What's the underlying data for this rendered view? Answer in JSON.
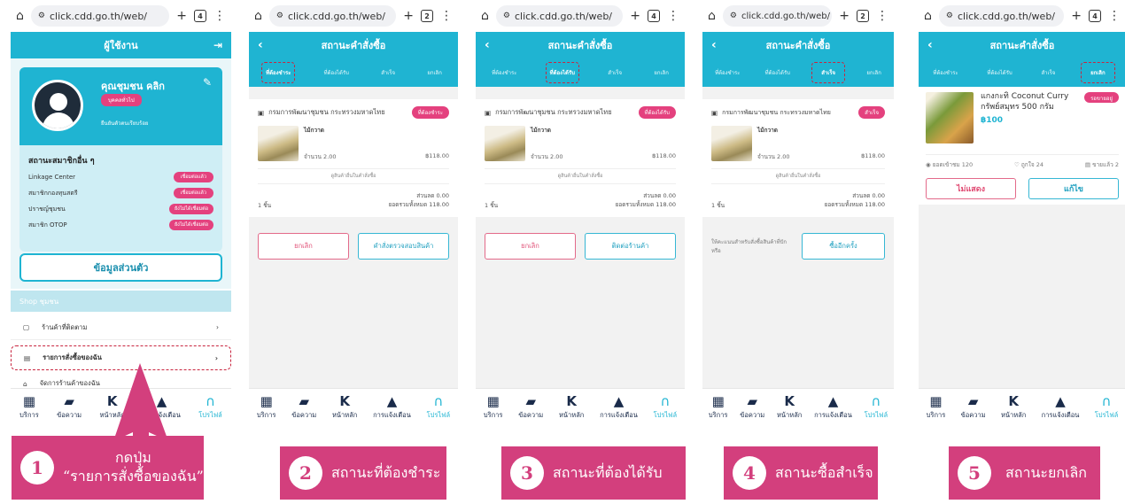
{
  "browser": {
    "url": "click.cdd.go.th/web/",
    "tab_counts": [
      "4",
      "2",
      "4",
      "2",
      "4"
    ]
  },
  "profile": {
    "header_title": "ผู้ใช้งาน",
    "name": "คุณชุมชน คลิก",
    "tag": "บุคคลทั่วไป",
    "verified": "ยืนยันตัวตนเรียบร้อย",
    "membership_title": "สถานะสมาชิกอื่น ๆ",
    "memberships": [
      {
        "label": "Linkage Center",
        "action": "เชื่อมต่อแล้ว"
      },
      {
        "label": "สมาชิกกองทุนสตรี",
        "action": "เชื่อมต่อแล้ว"
      },
      {
        "label": "ปราชญ์ชุมชน",
        "action": "ยังไม่ได้เชื่อมต่อ"
      },
      {
        "label": "สมาชิก OTOP",
        "action": "ยังไม่ได้เชื่อมต่อ"
      }
    ],
    "personal_info_button": "ข้อมูลส่วนตัว",
    "shop_section": "Shop ชุมชน",
    "menu": [
      "ร้านค้าที่ติดตาม",
      "รายการสั่งซื้อของฉัน",
      "จัดการร้านค้าของฉัน"
    ]
  },
  "order": {
    "header_title": "สถานะคำสั่งซื้อ",
    "tabs": [
      "ที่ต้องชำระ",
      "ที่ต้องได้รับ",
      "สำเร็จ",
      "ยกเลิก"
    ],
    "shop": "กรมการพัฒนาชุมชน กระทรวงมหาดไทย",
    "product": "ไม้กวาด",
    "quantity": "จำนวน 2.00",
    "price": "฿118.00",
    "more": "ดูสินค้าอื่นในคำสั่งซื้อ",
    "items": "1 ชิ้น",
    "discount": "ส่วนลด 0.00",
    "total": "ยอดรวมทั้งหมด 118.00",
    "status": [
      "ที่ต้องชำระ",
      "ที่ต้องได้รับ",
      "สำเร็จ"
    ],
    "cancel_button": "ยกเลิก",
    "check_button": "คำสั่งตรวจสอบสินค้า",
    "contact_button": "ติดต่อร้านค้า",
    "review_note": "ให้คะแนนสำหรับสั่งซื้อสินค้าที่ปัก หรือ",
    "rebuy_button": "ซื้ออีกครั้ง"
  },
  "cancelled": {
    "header_title": "สถานะคำสั่งซื้อ",
    "tabs": [
      "ที่ต้องชำระ",
      "ที่ต้องได้รับ",
      "สำเร็จ",
      "ยกเลิก"
    ],
    "product": "แกงกะทิ Coconut Curry กรัพย์สมุทร 500 กรัม",
    "status": "รอขายอยู่",
    "price": "฿100",
    "views": "ยอดเข้าชม 120",
    "likes": "ถูกใจ 24",
    "sold": "ขายแล้ว 2",
    "hide_button": "ไม่แสดง",
    "edit_button": "แก้ไข"
  },
  "nav": [
    "บริการ",
    "ข้อความ",
    "หน้าหลัก",
    "การแจ้งเตือน",
    "โปรไฟล์"
  ],
  "captions": [
    {
      "num": "1",
      "line1": "กดปุ่ม",
      "line2": "“รายการสั่งซื้อของฉัน”"
    },
    {
      "num": "2",
      "text": "สถานะที่ต้องชำระ"
    },
    {
      "num": "3",
      "text": "สถานะที่ต้องได้รับ"
    },
    {
      "num": "4",
      "text": "สถานะซื้อสำเร็จ"
    },
    {
      "num": "5",
      "text": "สถานะยกเลิก"
    }
  ],
  "colors": {
    "accent": "#1fb4d2",
    "pink": "#d33f7d",
    "button_pink": "#e4417e"
  }
}
